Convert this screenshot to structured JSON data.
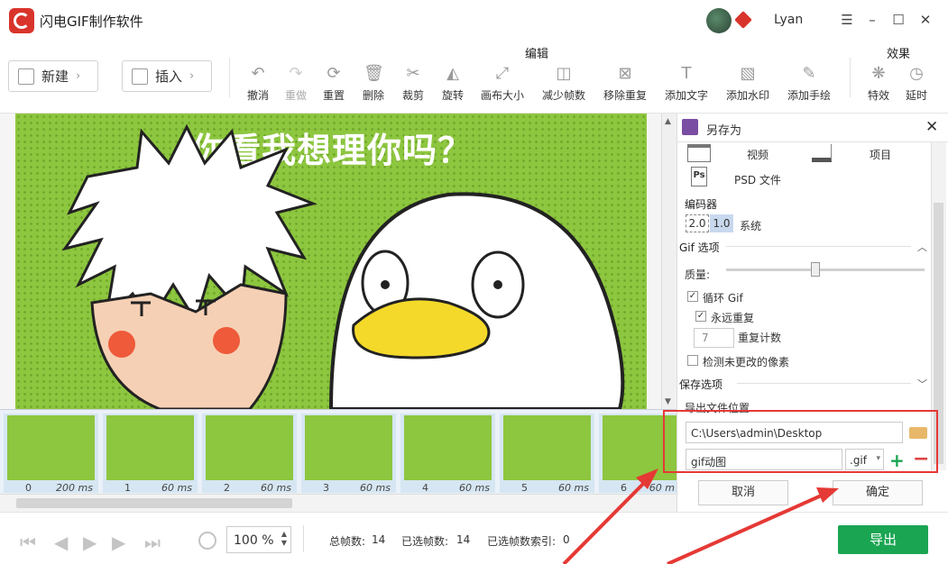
{
  "app": {
    "title": "闪电GIF制作软件",
    "username": "Lyan"
  },
  "toolbar": {
    "new_label": "新建",
    "insert_label": "插入",
    "group_edit": "编辑",
    "group_effects": "效果",
    "tools": [
      "撤消",
      "重做",
      "重置",
      "删除",
      "裁剪",
      "旋转",
      "画布大小",
      "减少帧数",
      "移除重复",
      "添加文字",
      "添加水印",
      "添加手绘"
    ],
    "effects": [
      "特效",
      "延时"
    ]
  },
  "preview": {
    "caption": "你看我想理你吗？"
  },
  "filmstrip": {
    "frames": [
      {
        "num": "0",
        "dur": "200 ms"
      },
      {
        "num": "1",
        "dur": "60 ms"
      },
      {
        "num": "2",
        "dur": "60 ms"
      },
      {
        "num": "3",
        "dur": "60 ms"
      },
      {
        "num": "4",
        "dur": "60 ms"
      },
      {
        "num": "5",
        "dur": "60 ms"
      },
      {
        "num": "6",
        "dur": "60 m"
      }
    ]
  },
  "bottom": {
    "zoom": "100",
    "zoom_unit": "%",
    "total_label": "总帧数:",
    "total": "14",
    "selected_label": "已选帧数:",
    "selected": "14",
    "index_label": "已选帧数索引:",
    "index": "0",
    "export_label": "导出"
  },
  "saveas": {
    "title": "另存为",
    "format_video": "视频",
    "format_project": "项目",
    "format_psd": "PSD 文件",
    "encoder_label": "编码器",
    "enc_20": "2.0",
    "enc_10": "1.0",
    "enc_system": "系统",
    "gif_options": "Gif 选项",
    "quality_label": "质量:",
    "quality": 0.45,
    "loop_gif": "循环 Gif",
    "forever": "永远重复",
    "repeat_count": "7",
    "repeat_label": "重复计数",
    "detect_unchanged": "检测未更改的像素",
    "save_options": "保存选项",
    "export_location": "导出文件位置",
    "path": "C:\\Users\\admin\\Desktop",
    "filename": "gif动图",
    "ext": ".gif",
    "cancel": "取消",
    "ok": "确定"
  },
  "colors": {
    "accent_green": "#1aa552",
    "brand_red": "#d9342b",
    "highlight_red": "#e53935",
    "gif_bg": "#8dc63f"
  }
}
